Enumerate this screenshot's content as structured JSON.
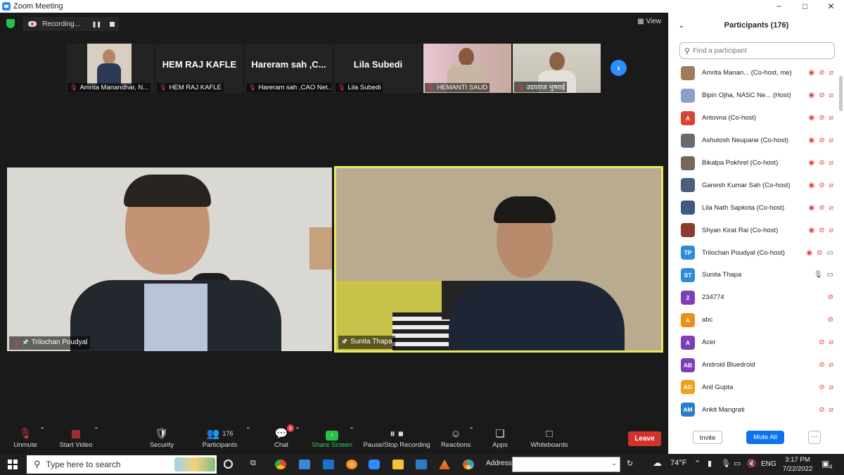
{
  "window": {
    "title": "Zoom Meeting",
    "controls": [
      "−",
      "□",
      "✕"
    ]
  },
  "recording": {
    "label": "Recording..."
  },
  "view": {
    "label": "View"
  },
  "thumbnails": [
    {
      "name": "",
      "label": "Amrita Manandhar, N..."
    },
    {
      "name": "HEM RAJ KAFLE",
      "label": "HEM RAJ KAFLE"
    },
    {
      "name": "Hareram sah ,C...",
      "label": "Hareram sah ,CAO Net..."
    },
    {
      "name": "Lila Subedi",
      "label": "Lila Subedi"
    },
    {
      "name": "",
      "label": "HEMANTI SAUD"
    },
    {
      "name": "",
      "label": "उदयराज भुषराई"
    }
  ],
  "tiles": {
    "left": "Trilochan Poudyal",
    "right": "Sunita Thapa"
  },
  "toolbar": {
    "unmute": "Unmute",
    "start_video": "Start Video",
    "security": "Security",
    "participants": "Participants",
    "participants_count": "176",
    "chat": "Chat",
    "chat_badge": "8",
    "share_screen": "Share Screen",
    "recording": "Pause/Stop Recording",
    "reactions": "Reactions",
    "apps": "Apps",
    "whiteboards": "Whiteboards",
    "leave": "Leave"
  },
  "panel": {
    "title": "Participants (176)",
    "search_placeholder": "Find a participant",
    "participants": [
      {
        "name": "Amrita Manan... (Co-host, me)",
        "initials": "",
        "color": "#a07a5a",
        "share": true,
        "mic": "off",
        "cam": "off"
      },
      {
        "name": "Bipin Ojha, NASC Ne...  (Host)",
        "initials": "",
        "color": "#8aa0c8",
        "share": true,
        "mic": "off",
        "cam": "off"
      },
      {
        "name": "Antovna (Co-host)",
        "initials": "A",
        "color": "#d84436",
        "share": true,
        "mic": "off",
        "cam": "off"
      },
      {
        "name": "Ashutosh Neupane (Co-host)",
        "initials": "",
        "color": "#6b6b6b",
        "share": true,
        "mic": "off",
        "cam": "off"
      },
      {
        "name": "Bikalpa Pokhrel (Co-host)",
        "initials": "",
        "color": "#7a6656",
        "share": true,
        "mic": "off",
        "cam": "off"
      },
      {
        "name": "Ganesh Kumar Sah (Co-host)",
        "initials": "",
        "color": "#4a5f7a",
        "share": true,
        "mic": "off",
        "cam": "off"
      },
      {
        "name": "Lila Nath Sapkota (Co-host)",
        "initials": "",
        "color": "#3d5a80",
        "share": true,
        "mic": "off",
        "cam": "off"
      },
      {
        "name": "Shyan Kirat Rai (Co-host)",
        "initials": "",
        "color": "#8a3a30",
        "share": true,
        "mic": "off",
        "cam": "off"
      },
      {
        "name": "Trilochan Poudyal (Co-host)",
        "initials": "TP",
        "color": "#2d8cd8",
        "share": true,
        "mic": "off",
        "cam": "on"
      },
      {
        "name": "Sunita Thapa",
        "initials": "ST",
        "color": "#2d8cd8",
        "share": false,
        "mic": "on",
        "cam": "on"
      },
      {
        "name": "234774",
        "initials": "2",
        "color": "#7b3fb8",
        "share": false,
        "mic": "off",
        "cam": "none"
      },
      {
        "name": "abc",
        "initials": "A",
        "color": "#f08c1a",
        "share": false,
        "mic": "off",
        "cam": "none"
      },
      {
        "name": "Acer",
        "initials": "A",
        "color": "#7b3fb8",
        "share": false,
        "mic": "off",
        "cam": "off"
      },
      {
        "name": "Android Bluedroid",
        "initials": "AB",
        "color": "#7b3fb8",
        "share": false,
        "mic": "off",
        "cam": "off"
      },
      {
        "name": "Anil Gupta",
        "initials": "AG",
        "color": "#f0a020",
        "share": false,
        "mic": "off",
        "cam": "off"
      },
      {
        "name": "Ankit Mangrati",
        "initials": "AM",
        "color": "#2d7cc8",
        "share": false,
        "mic": "off",
        "cam": "off"
      }
    ],
    "invite": "Invite",
    "mute_all": "Mute All",
    "more": "···"
  },
  "taskbar": {
    "search_placeholder": "Type here to search",
    "address_label": "Address",
    "weather": "74°F",
    "language": "ENG",
    "time": "3:17 PM",
    "date": "7/22/2022",
    "notifications": "4"
  }
}
